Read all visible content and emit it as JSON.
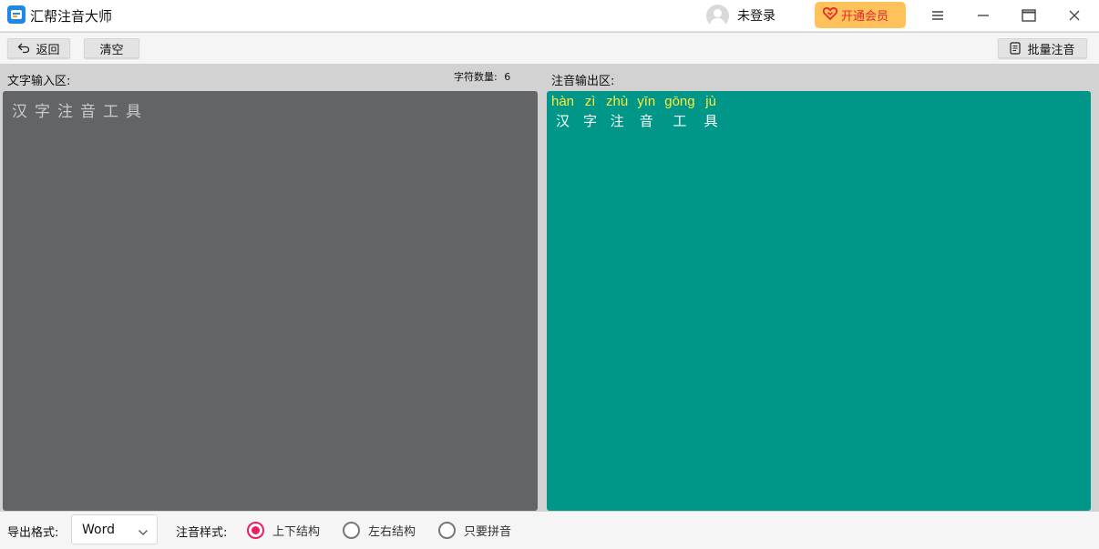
{
  "app": {
    "title": "汇帮注音大师"
  },
  "user": {
    "name": "未登录"
  },
  "vip": {
    "label": "开通会员"
  },
  "toolbar": {
    "back_label": "返回",
    "clear_label": "清空",
    "batch_label": "批量注音"
  },
  "input": {
    "label": "文字输入区:",
    "count_label": "字符数量:",
    "count_value": "6",
    "text": "汉字注音工具"
  },
  "output": {
    "label": "注音输出区:",
    "items": [
      {
        "pinyin": "hàn",
        "hanzi": "汉"
      },
      {
        "pinyin": "zì",
        "hanzi": "字"
      },
      {
        "pinyin": "zhù",
        "hanzi": "注"
      },
      {
        "pinyin": "yīn",
        "hanzi": "音"
      },
      {
        "pinyin": "gōng",
        "hanzi": "工"
      },
      {
        "pinyin": "jù",
        "hanzi": "具"
      }
    ]
  },
  "bottom": {
    "export_label": "导出格式:",
    "export_value": "Word",
    "style_label": "注音样式:",
    "styles": [
      {
        "label": "上下结构",
        "checked": true
      },
      {
        "label": "左右结构",
        "checked": false
      },
      {
        "label": "只要拼音",
        "checked": false
      }
    ]
  },
  "colors": {
    "accent": "#e91e63",
    "output_bg": "#009688",
    "input_bg": "#636468",
    "pinyin": "#ffeb3b",
    "vip_bg": "#ffc15a"
  }
}
